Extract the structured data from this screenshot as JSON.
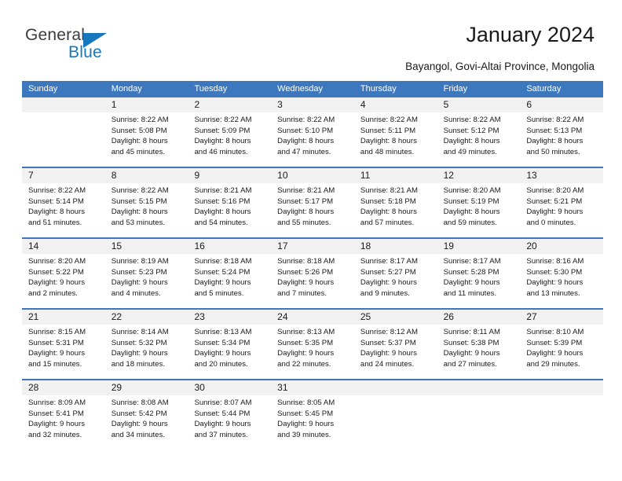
{
  "logo": {
    "name_top": "General",
    "name_bottom": "Blue",
    "triangle_color": "#1878be",
    "text_color": "#3c3c3c"
  },
  "header": {
    "title": "January 2024",
    "subtitle": "Bayangol, Govi-Altai Province, Mongolia"
  },
  "colors": {
    "header_blue": "#3d78bf",
    "row_separator_blue": "#3d78bf",
    "daynum_band": "#f1f1f1",
    "text": "#1a1a1a"
  },
  "weekday_headers": [
    "Sunday",
    "Monday",
    "Tuesday",
    "Wednesday",
    "Thursday",
    "Friday",
    "Saturday"
  ],
  "weeks": [
    {
      "days": [
        {
          "number": "",
          "lines": []
        },
        {
          "number": "1",
          "lines": [
            "Sunrise: 8:22 AM",
            "Sunset: 5:08 PM",
            "Daylight: 8 hours",
            "and 45 minutes."
          ]
        },
        {
          "number": "2",
          "lines": [
            "Sunrise: 8:22 AM",
            "Sunset: 5:09 PM",
            "Daylight: 8 hours",
            "and 46 minutes."
          ]
        },
        {
          "number": "3",
          "lines": [
            "Sunrise: 8:22 AM",
            "Sunset: 5:10 PM",
            "Daylight: 8 hours",
            "and 47 minutes."
          ]
        },
        {
          "number": "4",
          "lines": [
            "Sunrise: 8:22 AM",
            "Sunset: 5:11 PM",
            "Daylight: 8 hours",
            "and 48 minutes."
          ]
        },
        {
          "number": "5",
          "lines": [
            "Sunrise: 8:22 AM",
            "Sunset: 5:12 PM",
            "Daylight: 8 hours",
            "and 49 minutes."
          ]
        },
        {
          "number": "6",
          "lines": [
            "Sunrise: 8:22 AM",
            "Sunset: 5:13 PM",
            "Daylight: 8 hours",
            "and 50 minutes."
          ]
        }
      ]
    },
    {
      "days": [
        {
          "number": "7",
          "lines": [
            "Sunrise: 8:22 AM",
            "Sunset: 5:14 PM",
            "Daylight: 8 hours",
            "and 51 minutes."
          ]
        },
        {
          "number": "8",
          "lines": [
            "Sunrise: 8:22 AM",
            "Sunset: 5:15 PM",
            "Daylight: 8 hours",
            "and 53 minutes."
          ]
        },
        {
          "number": "9",
          "lines": [
            "Sunrise: 8:21 AM",
            "Sunset: 5:16 PM",
            "Daylight: 8 hours",
            "and 54 minutes."
          ]
        },
        {
          "number": "10",
          "lines": [
            "Sunrise: 8:21 AM",
            "Sunset: 5:17 PM",
            "Daylight: 8 hours",
            "and 55 minutes."
          ]
        },
        {
          "number": "11",
          "lines": [
            "Sunrise: 8:21 AM",
            "Sunset: 5:18 PM",
            "Daylight: 8 hours",
            "and 57 minutes."
          ]
        },
        {
          "number": "12",
          "lines": [
            "Sunrise: 8:20 AM",
            "Sunset: 5:19 PM",
            "Daylight: 8 hours",
            "and 59 minutes."
          ]
        },
        {
          "number": "13",
          "lines": [
            "Sunrise: 8:20 AM",
            "Sunset: 5:21 PM",
            "Daylight: 9 hours",
            "and 0 minutes."
          ]
        }
      ]
    },
    {
      "days": [
        {
          "number": "14",
          "lines": [
            "Sunrise: 8:20 AM",
            "Sunset: 5:22 PM",
            "Daylight: 9 hours",
            "and 2 minutes."
          ]
        },
        {
          "number": "15",
          "lines": [
            "Sunrise: 8:19 AM",
            "Sunset: 5:23 PM",
            "Daylight: 9 hours",
            "and 4 minutes."
          ]
        },
        {
          "number": "16",
          "lines": [
            "Sunrise: 8:18 AM",
            "Sunset: 5:24 PM",
            "Daylight: 9 hours",
            "and 5 minutes."
          ]
        },
        {
          "number": "17",
          "lines": [
            "Sunrise: 8:18 AM",
            "Sunset: 5:26 PM",
            "Daylight: 9 hours",
            "and 7 minutes."
          ]
        },
        {
          "number": "18",
          "lines": [
            "Sunrise: 8:17 AM",
            "Sunset: 5:27 PM",
            "Daylight: 9 hours",
            "and 9 minutes."
          ]
        },
        {
          "number": "19",
          "lines": [
            "Sunrise: 8:17 AM",
            "Sunset: 5:28 PM",
            "Daylight: 9 hours",
            "and 11 minutes."
          ]
        },
        {
          "number": "20",
          "lines": [
            "Sunrise: 8:16 AM",
            "Sunset: 5:30 PM",
            "Daylight: 9 hours",
            "and 13 minutes."
          ]
        }
      ]
    },
    {
      "days": [
        {
          "number": "21",
          "lines": [
            "Sunrise: 8:15 AM",
            "Sunset: 5:31 PM",
            "Daylight: 9 hours",
            "and 15 minutes."
          ]
        },
        {
          "number": "22",
          "lines": [
            "Sunrise: 8:14 AM",
            "Sunset: 5:32 PM",
            "Daylight: 9 hours",
            "and 18 minutes."
          ]
        },
        {
          "number": "23",
          "lines": [
            "Sunrise: 8:13 AM",
            "Sunset: 5:34 PM",
            "Daylight: 9 hours",
            "and 20 minutes."
          ]
        },
        {
          "number": "24",
          "lines": [
            "Sunrise: 8:13 AM",
            "Sunset: 5:35 PM",
            "Daylight: 9 hours",
            "and 22 minutes."
          ]
        },
        {
          "number": "25",
          "lines": [
            "Sunrise: 8:12 AM",
            "Sunset: 5:37 PM",
            "Daylight: 9 hours",
            "and 24 minutes."
          ]
        },
        {
          "number": "26",
          "lines": [
            "Sunrise: 8:11 AM",
            "Sunset: 5:38 PM",
            "Daylight: 9 hours",
            "and 27 minutes."
          ]
        },
        {
          "number": "27",
          "lines": [
            "Sunrise: 8:10 AM",
            "Sunset: 5:39 PM",
            "Daylight: 9 hours",
            "and 29 minutes."
          ]
        }
      ]
    },
    {
      "days": [
        {
          "number": "28",
          "lines": [
            "Sunrise: 8:09 AM",
            "Sunset: 5:41 PM",
            "Daylight: 9 hours",
            "and 32 minutes."
          ]
        },
        {
          "number": "29",
          "lines": [
            "Sunrise: 8:08 AM",
            "Sunset: 5:42 PM",
            "Daylight: 9 hours",
            "and 34 minutes."
          ]
        },
        {
          "number": "30",
          "lines": [
            "Sunrise: 8:07 AM",
            "Sunset: 5:44 PM",
            "Daylight: 9 hours",
            "and 37 minutes."
          ]
        },
        {
          "number": "31",
          "lines": [
            "Sunrise: 8:05 AM",
            "Sunset: 5:45 PM",
            "Daylight: 9 hours",
            "and 39 minutes."
          ]
        },
        {
          "number": "",
          "lines": []
        },
        {
          "number": "",
          "lines": []
        },
        {
          "number": "",
          "lines": []
        }
      ]
    }
  ]
}
